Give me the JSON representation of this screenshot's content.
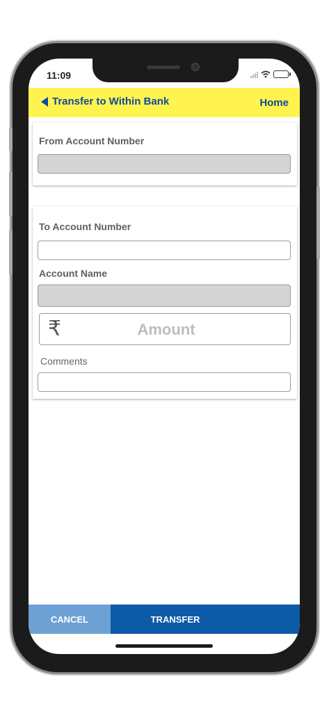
{
  "status_bar": {
    "time": "11:09"
  },
  "header": {
    "title": "Transfer to Within Bank",
    "home_label": "Home"
  },
  "from_card": {
    "label": "From Account Number",
    "value": ""
  },
  "to_card": {
    "to_account_label": "To Account Number",
    "to_account_value": "",
    "account_name_label": "Account Name",
    "account_name_value": "",
    "amount_placeholder": "Amount",
    "currency_symbol": "₹",
    "comments_label": "Comments",
    "comments_value": ""
  },
  "actions": {
    "cancel_label": "CANCEL",
    "transfer_label": "TRANSFER"
  },
  "colors": {
    "header_bg": "#fff44f",
    "header_text": "#12499b",
    "cancel_bg": "#6ea1d3",
    "transfer_bg": "#0d5aa8"
  }
}
